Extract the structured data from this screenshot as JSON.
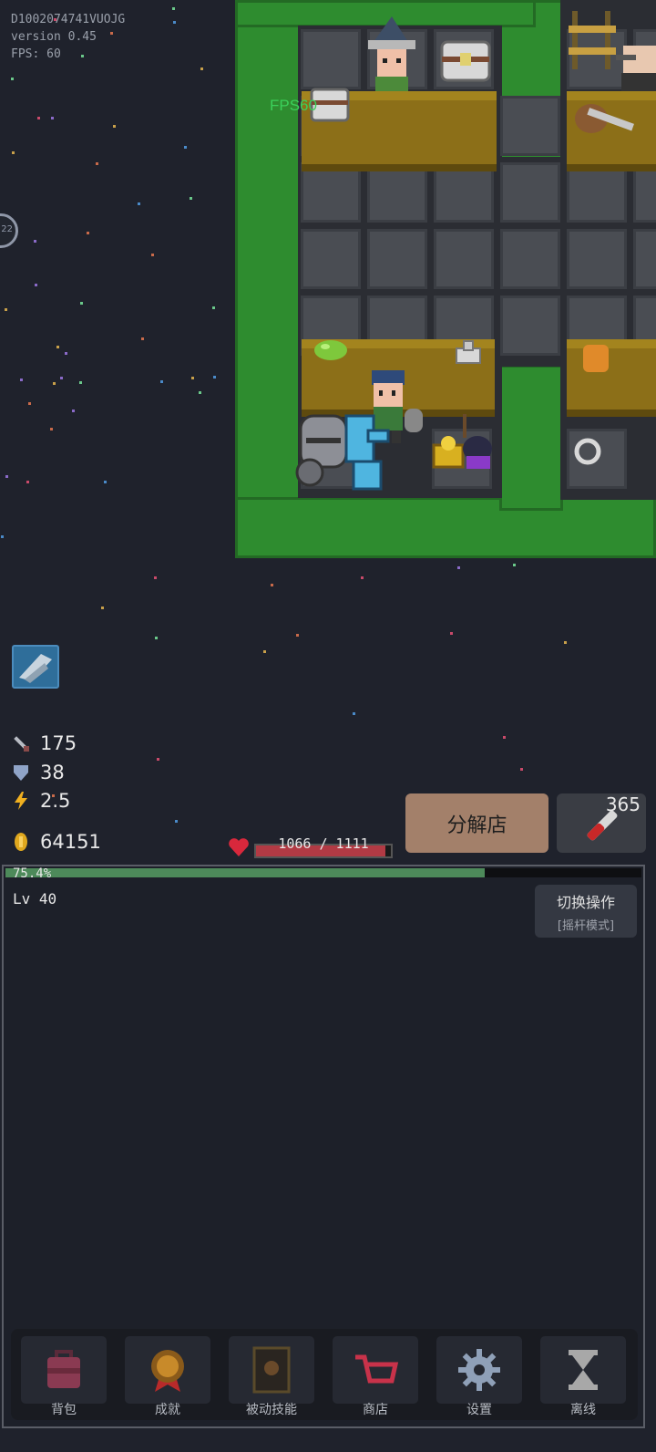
{
  "debug": {
    "device_id": "D1002074741VUOJG",
    "version": "version 0.45",
    "fps": "FPS: 60"
  },
  "fps_tag": "FPS60",
  "side_badge": "22",
  "stats": {
    "attack": "175",
    "defense": "38",
    "speed": "2.5",
    "gold": "64151"
  },
  "hp": {
    "text": "1066 / 1111",
    "current": 1066,
    "max": 1111
  },
  "shop_button": "分解店",
  "potion_count": "365",
  "xp": {
    "percent_text": "75.4%",
    "fraction": 0.754
  },
  "level": "Lv 40",
  "switch_mode": {
    "title": "切换操作",
    "subtitle": "[摇杆模式]"
  },
  "nav": [
    {
      "label": "背包",
      "icon": "backpack-icon"
    },
    {
      "label": "成就",
      "icon": "medal-icon"
    },
    {
      "label": "被动技能",
      "icon": "book-icon"
    },
    {
      "label": "商店",
      "icon": "cart-icon"
    },
    {
      "label": "设置",
      "icon": "gear-icon"
    },
    {
      "label": "离线",
      "icon": "hourglass-icon"
    }
  ],
  "colors": {
    "background": "#1f222c",
    "hedge": "#2e8c2f",
    "hp": "#b23a44",
    "xp": "#4d8a5a",
    "shop_button": "#a3806a"
  }
}
